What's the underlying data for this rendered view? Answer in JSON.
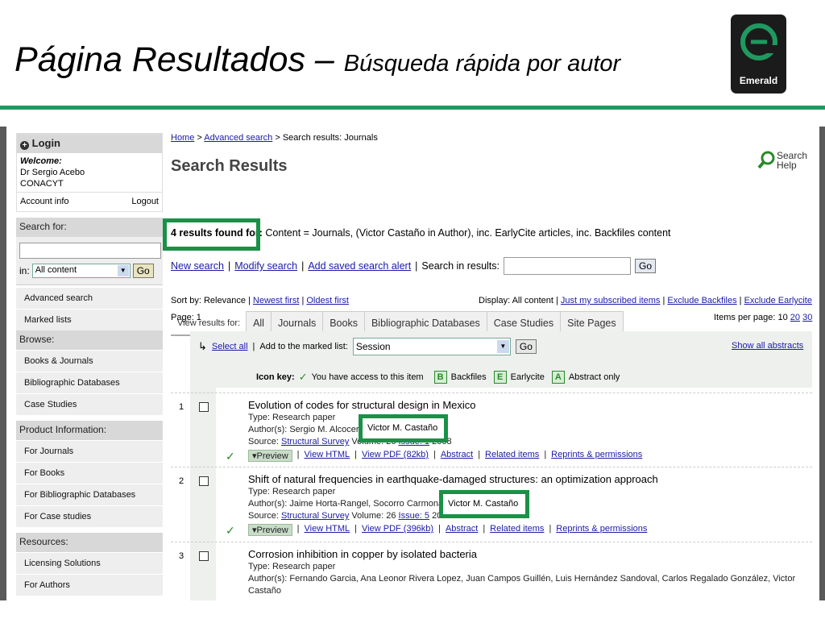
{
  "slide": {
    "title_main": "Página Resultados –",
    "title_sub": "Búsqueda rápida por autor",
    "logo_text": "Emerald"
  },
  "sidebar": {
    "login_label": "Login",
    "welcome": "Welcome:",
    "user_name": "Dr Sergio Acebo",
    "user_org": "CONACYT",
    "account_info": "Account info",
    "logout": "Logout",
    "search_for": "Search for:",
    "in_label": "in:",
    "in_select": "All content",
    "go": "Go",
    "advanced_search": "Advanced search",
    "marked_lists": "Marked lists",
    "browse_head": "Browse:",
    "browse_items": [
      "Books & Journals",
      "Bibliographic Databases",
      "Case Studies"
    ],
    "product_head": "Product Information:",
    "product_items": [
      "For Journals",
      "For Books",
      "For Bibliographic Databases",
      "For Case studies"
    ],
    "resources_head": "Resources:",
    "resources_items": [
      "Licensing Solutions",
      "For Authors"
    ]
  },
  "main": {
    "breadcrumb_home": "Home",
    "breadcrumb_sep1": ">",
    "breadcrumb_adv": "Advanced search",
    "breadcrumb_rest": "> Search results: Journals",
    "page_title": "Search Results",
    "search_help": "Search Help",
    "view_results_for": "View results for:",
    "tabs": [
      "All",
      "Journals",
      "Books",
      "Bibliographic Databases",
      "Case Studies",
      "Site Pages"
    ],
    "results_count": "4 results found for:",
    "results_query": "Content = Journals, (Victor Castaño in Author), inc. EarlyCite articles, inc. Backfiles content",
    "new_search": "New search",
    "modify_search": "Modify search",
    "add_alert": "Add saved search alert",
    "search_in_results": "Search in results:",
    "go": "Go",
    "sort_by": "Sort by: Relevance",
    "newest_first": "Newest first",
    "oldest_first": "Oldest first",
    "display_label": "Display: All content",
    "just_subscribed": "Just my subscribed items",
    "exclude_backfiles": "Exclude Backfiles",
    "exclude_earlycite": "Exclude Earlycite",
    "page_label": "Page: 1",
    "items_per_page": "Items per page: 10",
    "ipp_20": "20",
    "ipp_30": "30",
    "select_all": "Select all",
    "add_marked": "Add to the marked list:",
    "session_select": "Session",
    "show_abstracts": "Show all abstracts",
    "icon_key": "Icon key:",
    "access_text": "You have access to this item",
    "key_b": "B",
    "key_b_text": "Backfiles",
    "key_e": "E",
    "key_e_text": "Earlycite",
    "key_a": "A",
    "key_a_text": "Abstract only"
  },
  "results": [
    {
      "index": "1",
      "title": "Evolution of codes for structural design in Mexico",
      "type": "Type: Research paper",
      "authors": "Author(s): Sergio M. Alcocer,",
      "author_highlight": "Victor M. Castaño",
      "source_label": "Source:",
      "source_link": "Structural Survey",
      "source_rest": "Volume: 26",
      "issue": "Issue: 1",
      "year": "2008",
      "preview": "Preview",
      "view_html": "View HTML",
      "view_pdf": "View PDF (82kb)",
      "abstract": "Abstract",
      "related": "Related items",
      "reprints": "Reprints & permissions"
    },
    {
      "index": "2",
      "title": "Shift of natural frequencies in earthquake-damaged structures: an optimization approach",
      "type": "Type: Research paper",
      "authors": "Author(s): Jaime Horta-Rangel, Socorro Carmona,",
      "author_highlight": "Victor M. Castaño",
      "source_label": "Source:",
      "source_link": "Structural Survey",
      "source_rest": "Volume: 26",
      "issue": "Issue: 5",
      "year": "2008",
      "preview": "Preview",
      "view_html": "View HTML",
      "view_pdf": "View PDF (396kb)",
      "abstract": "Abstract",
      "related": "Related items",
      "reprints": "Reprints & permissions"
    },
    {
      "index": "3",
      "title": "Corrosion inhibition in copper by isolated bacteria",
      "type": "Type: Research paper",
      "authors": "Author(s): Fernando Garcia, Ana Leonor Rivera Lopez, Juan Campos Guillén, Luis Hernández Sandoval, Carlos Regalado González, Victor",
      "authors_cont": "Castaño"
    }
  ],
  "colors": {
    "accent": "#1a9146",
    "link": "#1a1aa6"
  }
}
